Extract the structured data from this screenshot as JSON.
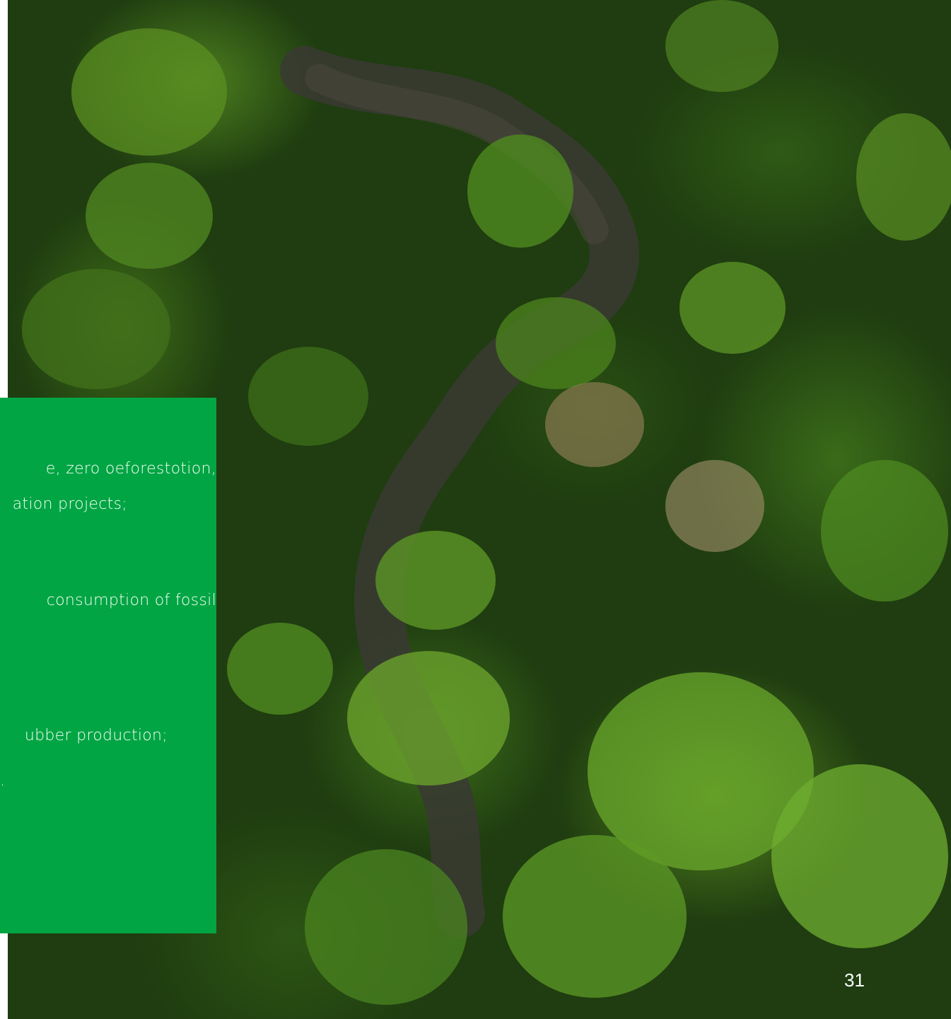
{
  "panel": {
    "color": "#02A544",
    "lines": [
      "e, zero oeforestotion,",
      "ation projects;",
      "consumption of fossil",
      "ubber production;",
      "."
    ]
  },
  "page_number": "31"
}
